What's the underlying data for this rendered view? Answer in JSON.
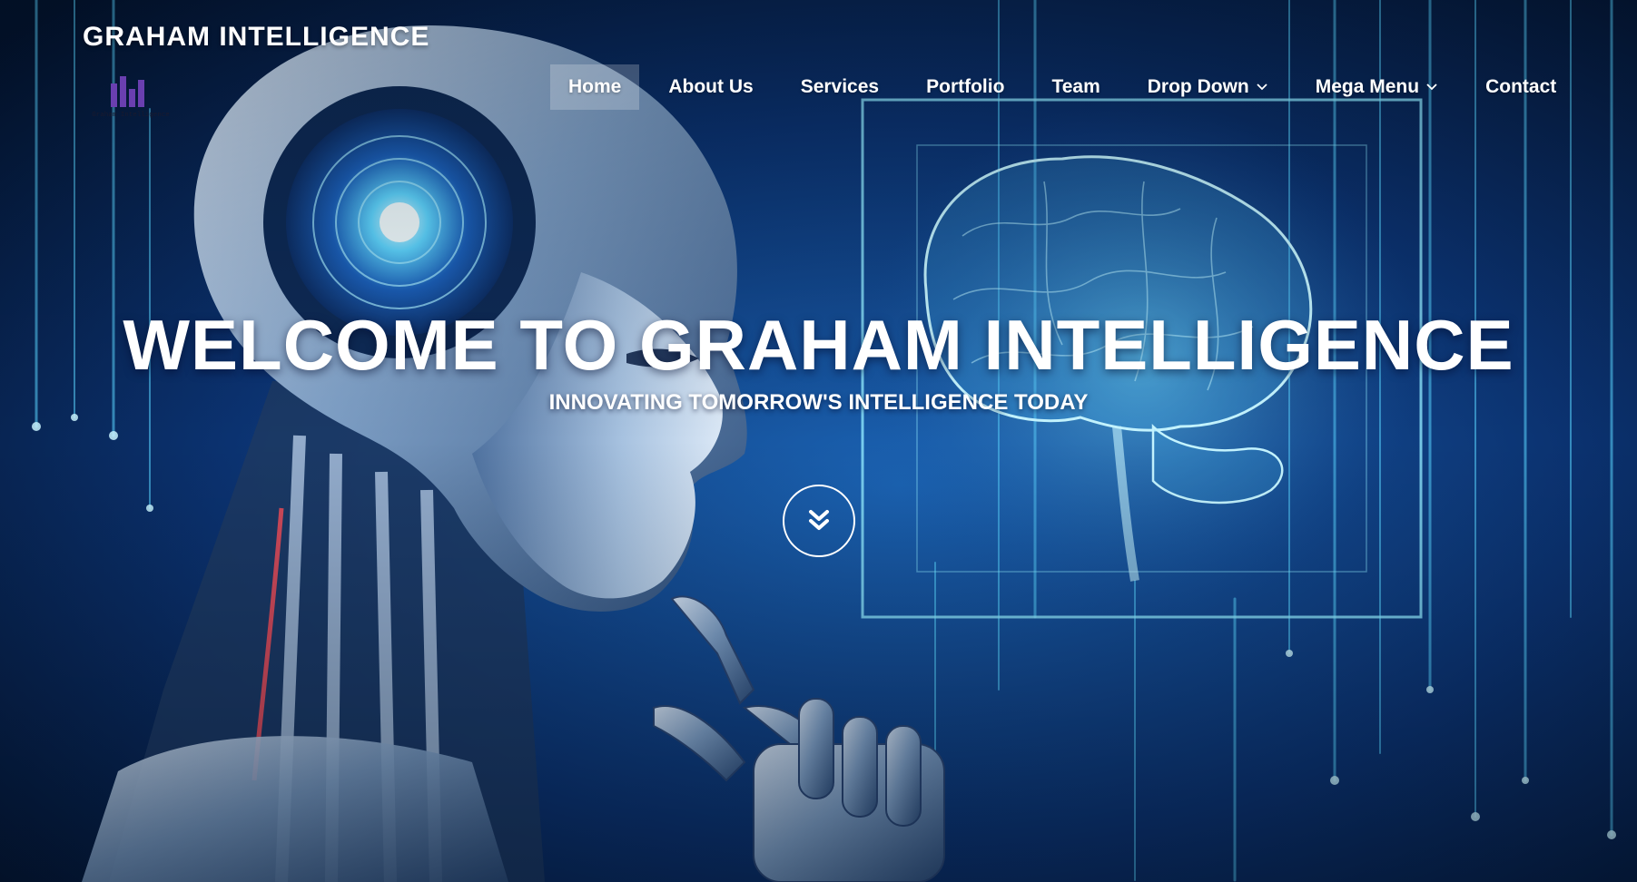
{
  "site": {
    "title": "GRAHAM INTELLIGENCE",
    "logo_caption": "Graham Intelligence"
  },
  "nav": {
    "items": [
      {
        "label": "Home",
        "active": true
      },
      {
        "label": "About Us"
      },
      {
        "label": "Services"
      },
      {
        "label": "Portfolio"
      },
      {
        "label": "Team"
      },
      {
        "label": "Drop Down",
        "has_dropdown": true
      },
      {
        "label": "Mega Menu",
        "has_dropdown": true
      },
      {
        "label": "Contact"
      }
    ]
  },
  "hero": {
    "title": "WELCOME TO GRAHAM INTELLIGENCE",
    "subtitle": "INNOVATING TOMORROW'S INTELLIGENCE TODAY",
    "scroll_icon": "double-chevron-down-icon"
  },
  "colors": {
    "background_deep": "#04142e",
    "background_glow": "#1d6fc4",
    "accent_cyan": "#6fe4ff",
    "text": "#ffffff",
    "logo_purple": "#6a3fb0"
  }
}
